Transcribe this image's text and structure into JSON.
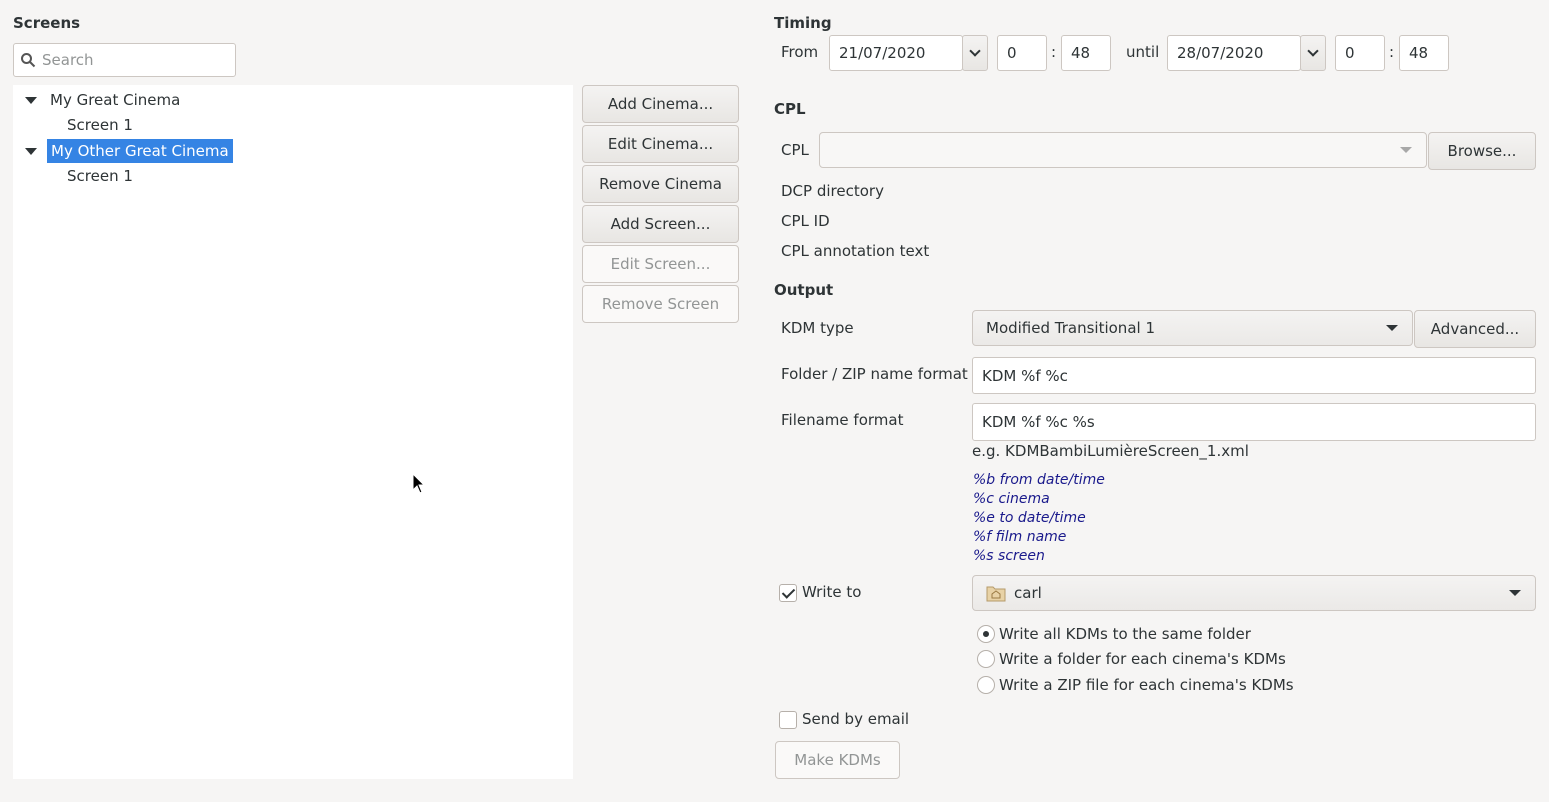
{
  "screens": {
    "title": "Screens",
    "search_placeholder": "Search",
    "tree": [
      {
        "name": "My Great Cinema",
        "screens": [
          "Screen 1"
        ]
      },
      {
        "name": "My Other Great Cinema",
        "screens": [
          "Screen 1"
        ],
        "selected": true
      }
    ],
    "buttons": {
      "add_cinema": "Add Cinema...",
      "edit_cinema": "Edit Cinema...",
      "remove_cinema": "Remove Cinema",
      "add_screen": "Add Screen...",
      "edit_screen": "Edit Screen...",
      "remove_screen": "Remove Screen"
    }
  },
  "timing": {
    "title": "Timing",
    "from_label": "From",
    "from_date": "21/07/2020",
    "from_hour": "0",
    "from_minute": "48",
    "until_label": "until",
    "until_date": "28/07/2020",
    "until_hour": "0",
    "until_minute": "48",
    "colon": ":"
  },
  "cpl": {
    "title": "CPL",
    "cpl_label": "CPL",
    "cpl_value": "",
    "browse": "Browse...",
    "dcp_directory": "DCP directory",
    "cpl_id": "CPL ID",
    "cpl_annotation": "CPL annotation text"
  },
  "output": {
    "title": "Output",
    "kdm_type_label": "KDM type",
    "kdm_type_value": "Modified Transitional 1",
    "advanced": "Advanced...",
    "folder_format_label": "Folder / ZIP name format",
    "folder_format_value": "KDM %f %c",
    "filename_format_label": "Filename format",
    "filename_format_value": "KDM %f %c %s",
    "example": "e.g. KDMBambiLumièreScreen_1.xml",
    "hints": [
      "%b from date/time",
      "%c cinema",
      "%e to date/time",
      "%f film name",
      "%s screen"
    ],
    "write_to_label": "Write to",
    "write_to_checked": true,
    "write_to_folder": "carl",
    "radio_options": [
      "Write all KDMs to the same folder",
      "Write a folder for each cinema's KDMs",
      "Write a ZIP file for each cinema's KDMs"
    ],
    "radio_selected": 0,
    "send_email_label": "Send by email",
    "send_email_checked": false,
    "make_kdms": "Make KDMs"
  }
}
